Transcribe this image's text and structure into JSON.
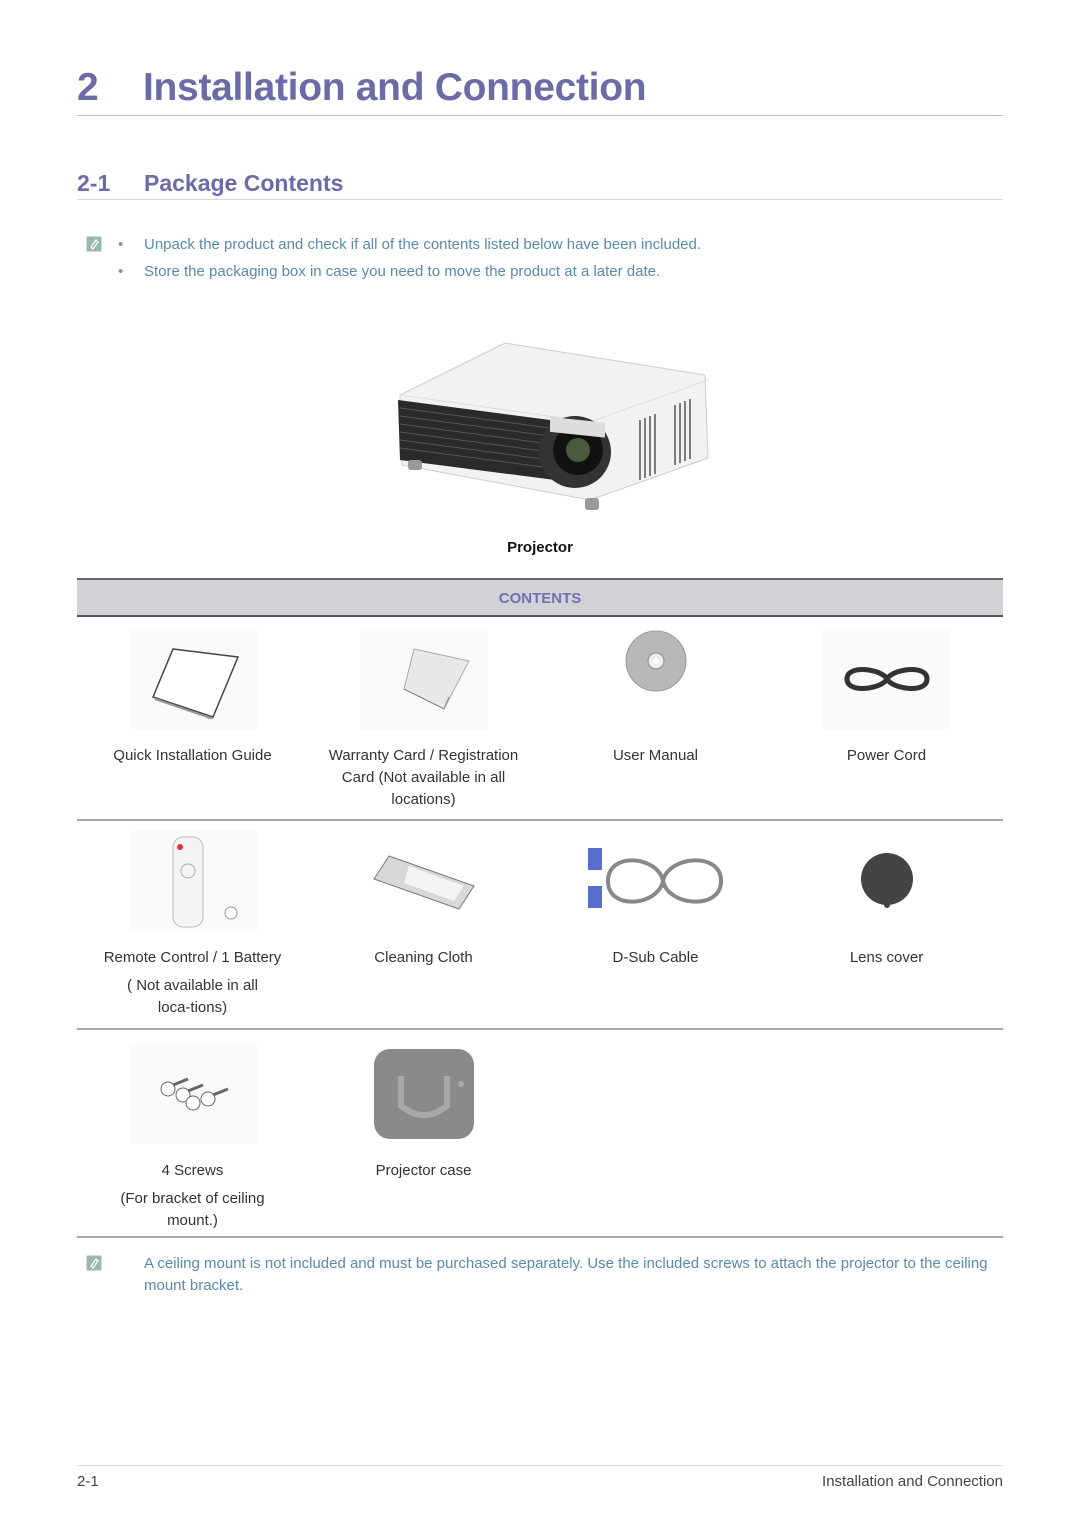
{
  "chapter": {
    "number": "2",
    "title": "Installation and Connection"
  },
  "section": {
    "number": "2-1",
    "title": "Package Contents"
  },
  "intro_notes": [
    "Unpack the product and check if all of the contents listed below have been included.",
    "Store the packaging box in case you need to move the product at a later date."
  ],
  "main_item": {
    "label": "Projector",
    "icon": "projector-image"
  },
  "contents_header": "CONTENTS",
  "contents_rows": [
    [
      {
        "label": "Quick Installation Guide",
        "sub": "",
        "icon": "booklet-image"
      },
      {
        "label": "Warranty Card / Registration Card (Not available in all locations)",
        "sub": "",
        "icon": "warranty-card-image"
      },
      {
        "label": "User Manual",
        "sub": "",
        "icon": "cd-disc-image"
      },
      {
        "label": "Power Cord",
        "sub": "",
        "icon": "power-cord-image"
      }
    ],
    [
      {
        "label": "Remote Control / 1 Battery",
        "sub": "( Not available in all loca-tions)",
        "icon": "remote-control-image"
      },
      {
        "label": "Cleaning Cloth",
        "sub": "",
        "icon": "cleaning-cloth-image"
      },
      {
        "label": "D-Sub Cable",
        "sub": "",
        "icon": "dsub-cable-image"
      },
      {
        "label": "Lens cover",
        "sub": "",
        "icon": "lens-cover-image"
      }
    ],
    [
      {
        "label": "4 Screws",
        "sub": "(For bracket of ceiling mount.)",
        "icon": "screws-image"
      },
      {
        "label": "Projector case",
        "sub": "",
        "icon": "projector-case-image"
      }
    ]
  ],
  "ceiling_note": "A ceiling mount is not included and must be purchased separately. Use the included screws to attach the projector to the ceiling mount bracket.",
  "footer": {
    "page": "2-1",
    "chapter": "Installation and Connection"
  },
  "colors": {
    "heading": "#6b6ba8",
    "note_text": "#5a8aaa",
    "contents_bar": "#d2d3d6"
  }
}
